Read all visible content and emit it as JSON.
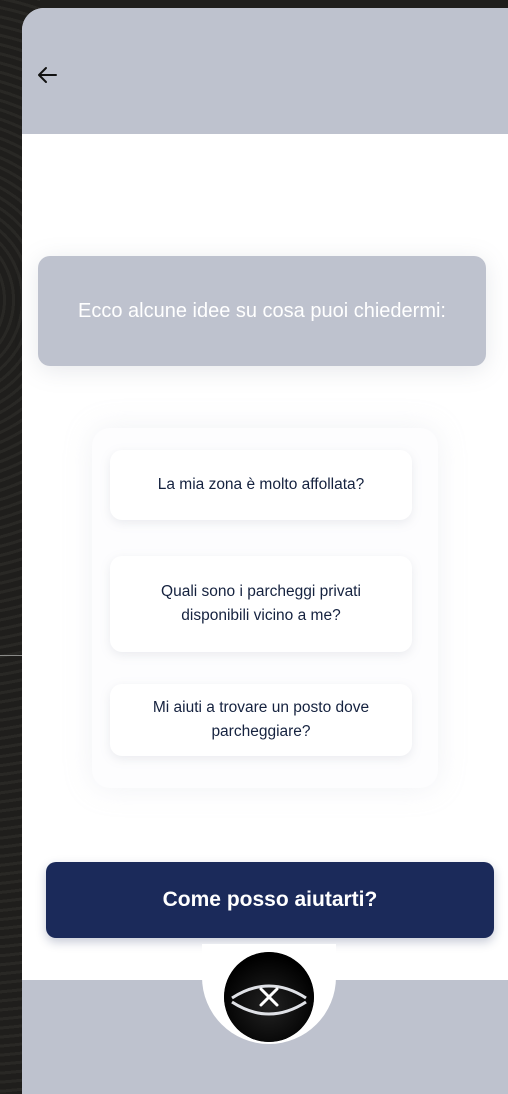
{
  "header": {
    "back_icon": "arrow-left-icon"
  },
  "intro": {
    "text": "Ecco alcune idee su cosa puoi chiedermi:"
  },
  "suggestions": [
    {
      "text": "La mia zona è molto affollata?"
    },
    {
      "text": "Quali sono i parcheggi privati disponibili vicino a me?"
    },
    {
      "text": "Mi aiuti a trovare un posto dove parcheggiare?"
    }
  ],
  "ask_button": {
    "label": "Come posso aiutarti?"
  },
  "close_button": {
    "icon": "close-icon"
  },
  "colors": {
    "header_bg": "#bec2ce",
    "primary": "#1b2a5a",
    "suggestion_text": "#15223f"
  }
}
